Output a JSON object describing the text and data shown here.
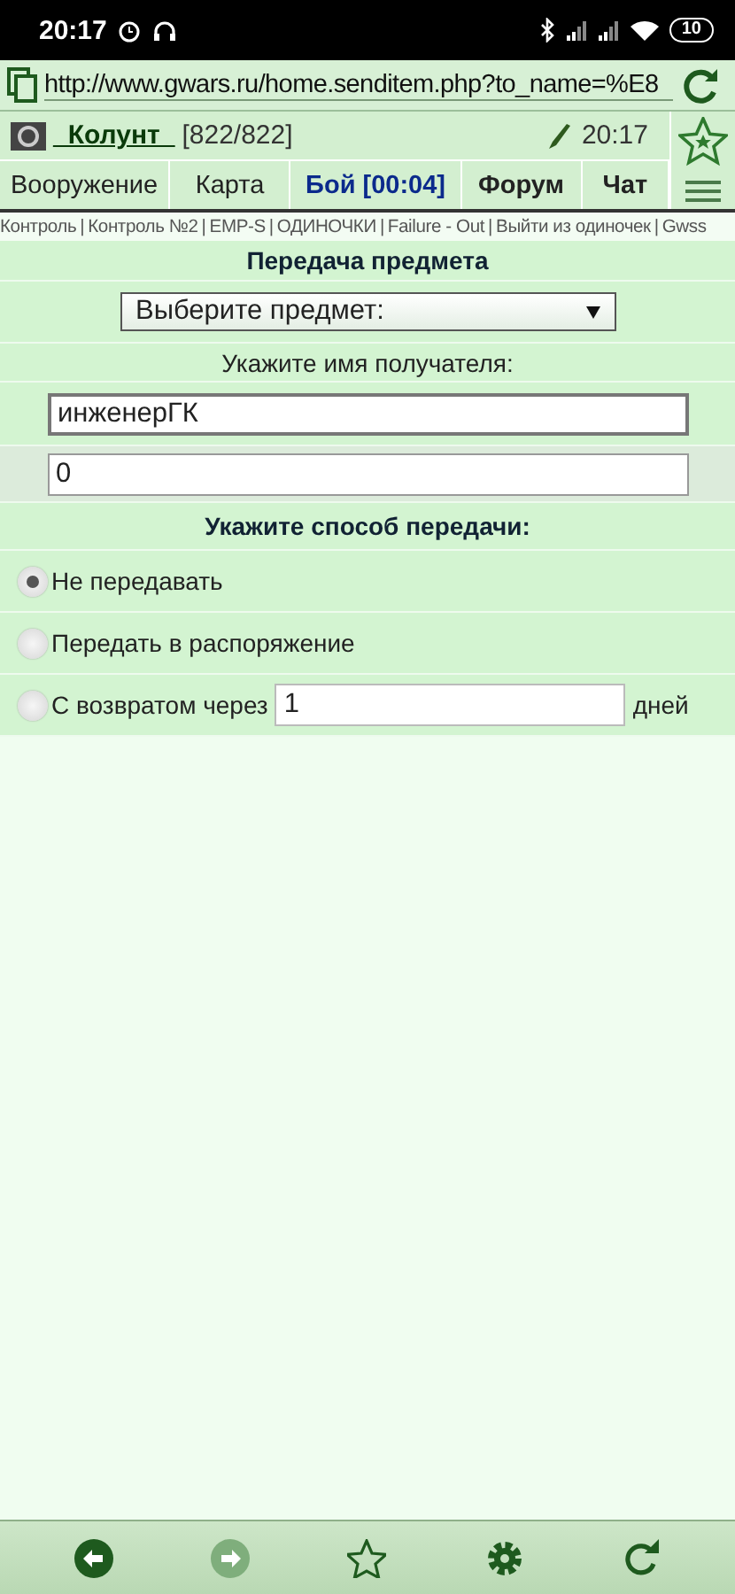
{
  "status_bar": {
    "time": "20:17",
    "battery": "10"
  },
  "address_bar": {
    "url": "http://www.gwars.ru/home.senditem.php?to_name=%E8"
  },
  "header": {
    "player_name": "_Колунт_",
    "hp": "[822/822]",
    "time": "20:17"
  },
  "tabs": [
    {
      "label": "Вооружение",
      "kind": "plain"
    },
    {
      "label": "Карта",
      "kind": "plain"
    },
    {
      "label": "Бой [00:04]",
      "kind": "alert"
    },
    {
      "label": "Форум",
      "kind": "bold"
    },
    {
      "label": "Чат",
      "kind": "bold"
    }
  ],
  "quick_links": {
    "separator": "|",
    "links": [
      "Контроль",
      "Контроль №2",
      "EMP-S",
      "ОДИНОЧКИ",
      "Failure - Out",
      "Выйти из одиночек",
      "Gwss"
    ]
  },
  "form": {
    "title": "Передача предмета",
    "item_select": {
      "value": "Выберите предмет:"
    },
    "recipient_label": "Укажите имя получателя:",
    "recipient": {
      "value": "инженерГК"
    },
    "amount": {
      "value": "0"
    },
    "method_label": "Укажите способ передачи:",
    "methods": [
      {
        "label": "Не передавать",
        "selected": true,
        "kind": "plain"
      },
      {
        "label": "Передать в распоряжение",
        "selected": false,
        "kind": "plain"
      },
      {
        "label": "С возвратом через",
        "selected": false,
        "kind": "days",
        "days": {
          "value": "1"
        },
        "unit": "дней"
      }
    ]
  },
  "bottom_nav": [
    {
      "kind": "back",
      "disabled": false
    },
    {
      "kind": "forward",
      "disabled": true
    },
    {
      "kind": "star",
      "disabled": false
    },
    {
      "kind": "settings",
      "disabled": false
    },
    {
      "kind": "reload",
      "disabled": false
    }
  ]
}
